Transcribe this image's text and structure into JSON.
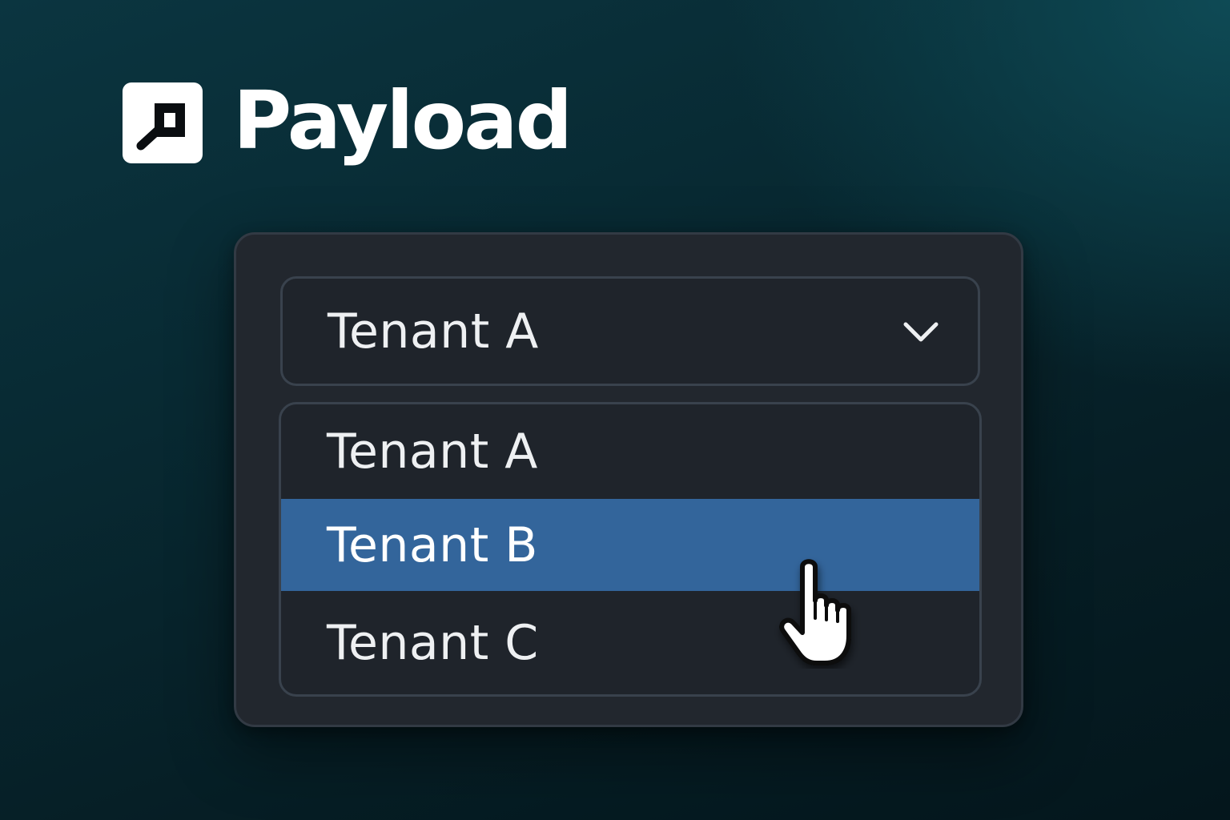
{
  "brand": {
    "name": "Payload",
    "logo_icon": "payload-logo-icon"
  },
  "tenant_select": {
    "selected_value": "Tenant A",
    "toggle_icon": "chevron-down-icon",
    "options": [
      {
        "label": "Tenant A"
      },
      {
        "label": "Tenant B",
        "highlighted": true
      },
      {
        "label": "Tenant C"
      }
    ]
  },
  "cursor": {
    "icon": "hand-pointer-icon",
    "hovering_option": "Tenant B"
  },
  "colors": {
    "background_top": "#0e4a55",
    "background_bottom": "#04161c",
    "panel": "#22272e",
    "highlight": "#33659b",
    "text": "#eef0f2"
  }
}
